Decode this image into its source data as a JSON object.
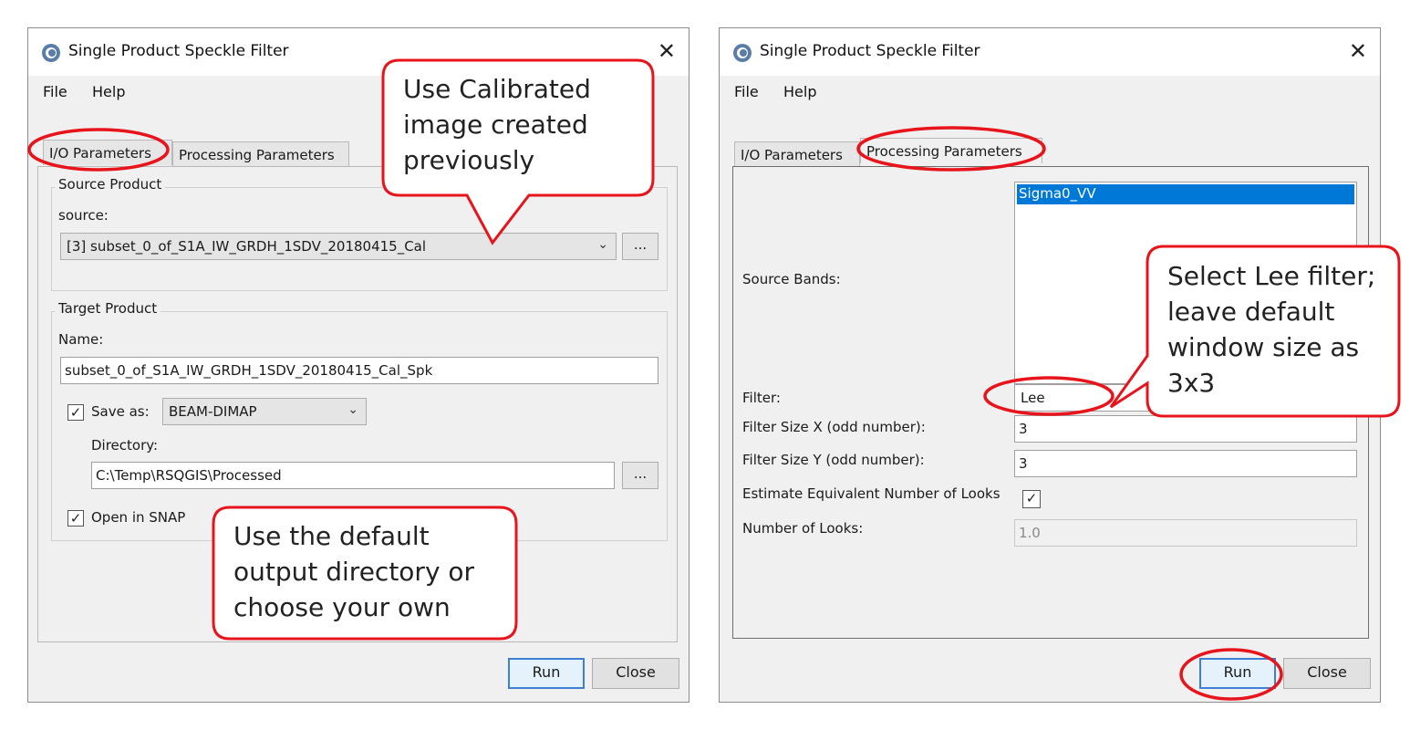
{
  "left_dialog": {
    "title": "Single Product Speckle Filter",
    "close_glyph": "✕",
    "menu": {
      "file": "File",
      "help": "Help"
    },
    "tabs": {
      "io": "I/O Parameters",
      "processing": "Processing Parameters"
    },
    "source_group": {
      "title": "Source Product",
      "source_label": "source:",
      "source_value": "[3] subset_0_of_S1A_IW_GRDH_1SDV_20180415_Cal",
      "browse": "..."
    },
    "target_group": {
      "title": "Target Product",
      "name_label": "Name:",
      "name_value": "subset_0_of_S1A_IW_GRDH_1SDV_20180415_Cal_Spk",
      "save_as_label": "Save as:",
      "save_as_checked": true,
      "format": "BEAM-DIMAP",
      "directory_label": "Directory:",
      "directory_value": "C:\\Temp\\RSQGIS\\Processed",
      "browse": "...",
      "open_in_snap_label": "Open in SNAP",
      "open_in_snap_checked": true
    },
    "buttons": {
      "run": "Run",
      "close": "Close"
    }
  },
  "right_dialog": {
    "title": "Single Product Speckle Filter",
    "close_glyph": "✕",
    "menu": {
      "file": "File",
      "help": "Help"
    },
    "tabs": {
      "io": "I/O Parameters",
      "processing": "Processing Parameters"
    },
    "fields": {
      "source_bands_label": "Source Bands:",
      "source_bands_items": [
        "Sigma0_VV"
      ],
      "filter_label": "Filter:",
      "filter_value": "Lee",
      "filter_size_x_label": "Filter Size X (odd number):",
      "filter_size_x_value": "3",
      "filter_size_y_label": "Filter Size Y (odd number):",
      "filter_size_y_value": "3",
      "enl_label": "Estimate Equivalent Number of Looks",
      "enl_checked": true,
      "looks_label": "Number of Looks:",
      "looks_value": "1.0"
    },
    "buttons": {
      "run": "Run",
      "close": "Close"
    }
  },
  "annotations": {
    "callout_calibrated": "Use Calibrated\nimage created\npreviously",
    "callout_directory": "Use the default\noutput directory or\n choose your own",
    "callout_lee": "Select Lee filter;\nleave default\nwindow size as\n3x3",
    "highlight_color": "#e8141b"
  },
  "colors": {
    "dialog_bg": "#f0f0f0",
    "selection": "#0078d7",
    "default_button_border": "#3c7fd4"
  }
}
